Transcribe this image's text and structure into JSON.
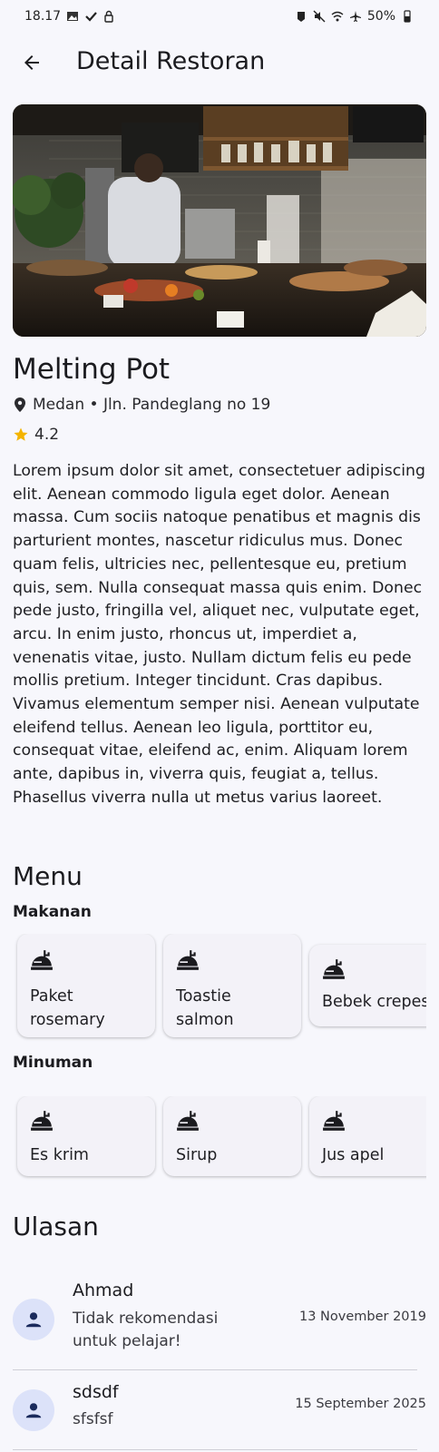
{
  "status_bar": {
    "time": "18.17",
    "battery": "50%"
  },
  "appbar": {
    "title": "Detail Restoran"
  },
  "restaurant": {
    "name": "Melting Pot",
    "location": "Medan • Jln. Pandeglang no 19",
    "rating": "4.2",
    "description": "Lorem ipsum dolor sit amet, consectetuer adipiscing elit. Aenean commodo ligula eget dolor. Aenean massa. Cum sociis natoque penatibus et magnis dis parturient montes, nascetur ridiculus mus. Donec quam felis, ultricies nec, pellentesque eu, pretium quis, sem. Nulla consequat massa quis enim. Donec pede justo, fringilla vel, aliquet nec, vulputate eget, arcu. In enim justo, rhoncus ut, imperdiet a, venenatis vitae, justo. Nullam dictum felis eu pede mollis pretium. Integer tincidunt. Cras dapibus. Vivamus elementum semper nisi. Aenean vulputate eleifend tellus. Aenean leo ligula, porttitor eu, consequat vitae, eleifend ac, enim. Aliquam lorem ante, dapibus in, viverra quis, feugiat a, tellus. Phasellus viverra nulla ut metus varius laoreet."
  },
  "menu": {
    "title": "Menu",
    "foods": {
      "title": "Makanan",
      "items": [
        "Paket rosemary",
        "Toastie salmon",
        "Bebek crepes"
      ]
    },
    "drinks": {
      "title": "Minuman",
      "items": [
        "Es krim",
        "Sirup",
        "Jus apel"
      ]
    }
  },
  "reviews": {
    "title": "Ulasan",
    "items": [
      {
        "name": "Ahmad",
        "text": "Tidak rekomendasi untuk pelajar!",
        "date": "13 November 2019"
      },
      {
        "name": "sdsdf",
        "text": "sfsfsf",
        "date": "15 September 2025"
      }
    ]
  },
  "colors": {
    "background": "#f7f7fc",
    "avatar_bg": "#dce2f9",
    "avatar_icon": "#1a2a5c",
    "card_bg": "#f3f2f8",
    "star": "#f4b400"
  },
  "icons": {
    "back": "arrow-left-icon",
    "location": "location-pin-icon",
    "rating": "star-icon",
    "menu_item": "food-dish-icon",
    "reviewer": "person-icon"
  }
}
